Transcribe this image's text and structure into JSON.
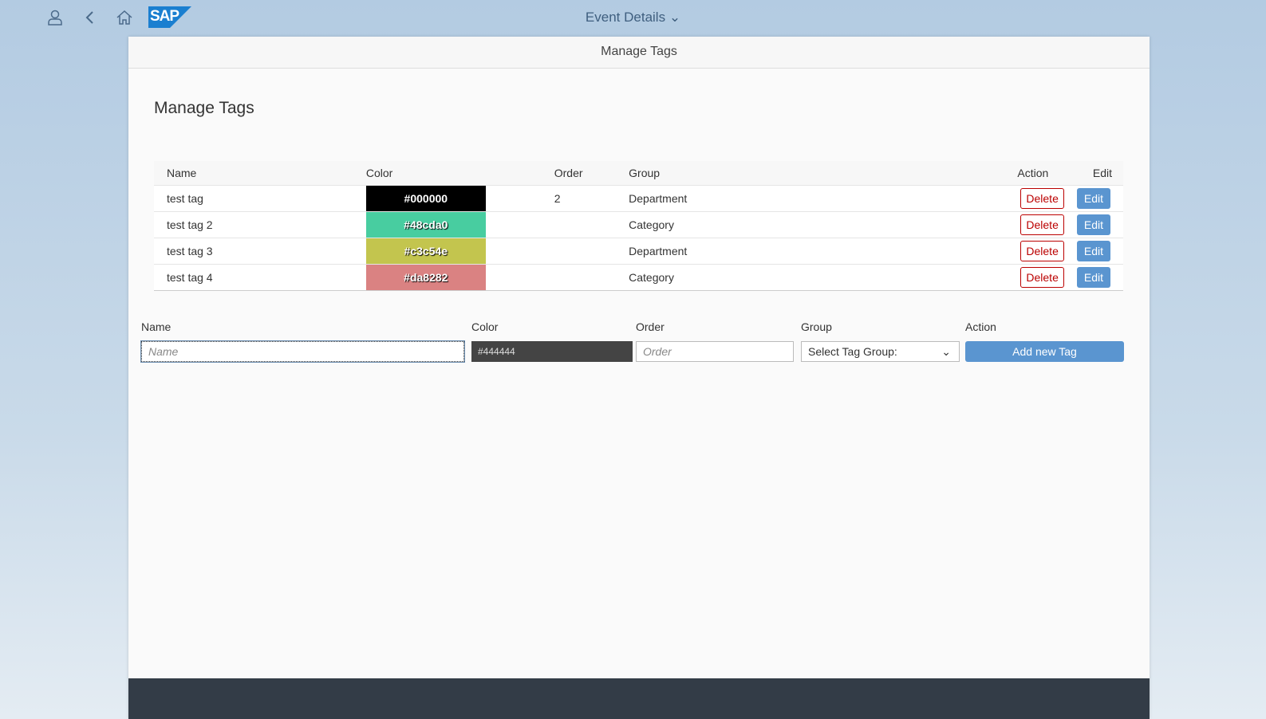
{
  "shell": {
    "title": "Event Details",
    "logo": "SAP"
  },
  "page": {
    "header": "Manage Tags",
    "heading": "Manage Tags"
  },
  "table": {
    "columns": [
      "Name",
      "Color",
      "Order",
      "Group",
      "Action",
      "Edit"
    ],
    "rows": [
      {
        "name": "test tag",
        "color": "#000000",
        "order": "2",
        "group": "Department"
      },
      {
        "name": "test tag 2",
        "color": "#48cda0",
        "order": "",
        "group": "Category"
      },
      {
        "name": "test tag 3",
        "color": "#c3c54e",
        "order": "",
        "group": "Department"
      },
      {
        "name": "test tag 4",
        "color": "#da8282",
        "order": "",
        "group": "Category"
      }
    ],
    "delete_label": "Delete",
    "edit_label": "Edit"
  },
  "form": {
    "labels": [
      "Name",
      "Color",
      "Order",
      "Group",
      "Action"
    ],
    "name_placeholder": "Name",
    "color_value": "#444444",
    "order_placeholder": "Order",
    "group_select": "Select Tag Group:",
    "add_label": "Add new Tag"
  }
}
